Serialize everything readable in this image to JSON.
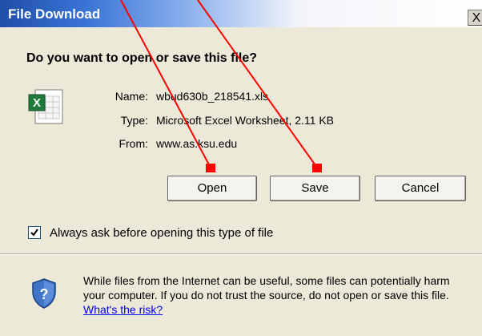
{
  "window": {
    "title": "File Download",
    "close_label": "X"
  },
  "dialog": {
    "question": "Do you want to open or save this file?",
    "file": {
      "name_label": "Name:",
      "name_value": "wbud630b_218541.xls",
      "type_label": "Type:",
      "type_value": "Microsoft Excel Worksheet, 2.11 KB",
      "from_label": "From:",
      "from_value": "www.as.ksu.edu"
    },
    "buttons": {
      "open": "Open",
      "save": "Save",
      "cancel": "Cancel"
    },
    "checkbox": {
      "label": "Always ask before opening this type of file",
      "checked": true
    },
    "warning": {
      "text": "While files from the Internet can be useful, some files can potentially harm your computer. If you do not trust the source, do not open or save this file.",
      "link_text": "What's the risk?"
    }
  },
  "annotations": {
    "marker_color": "#ff0000"
  }
}
